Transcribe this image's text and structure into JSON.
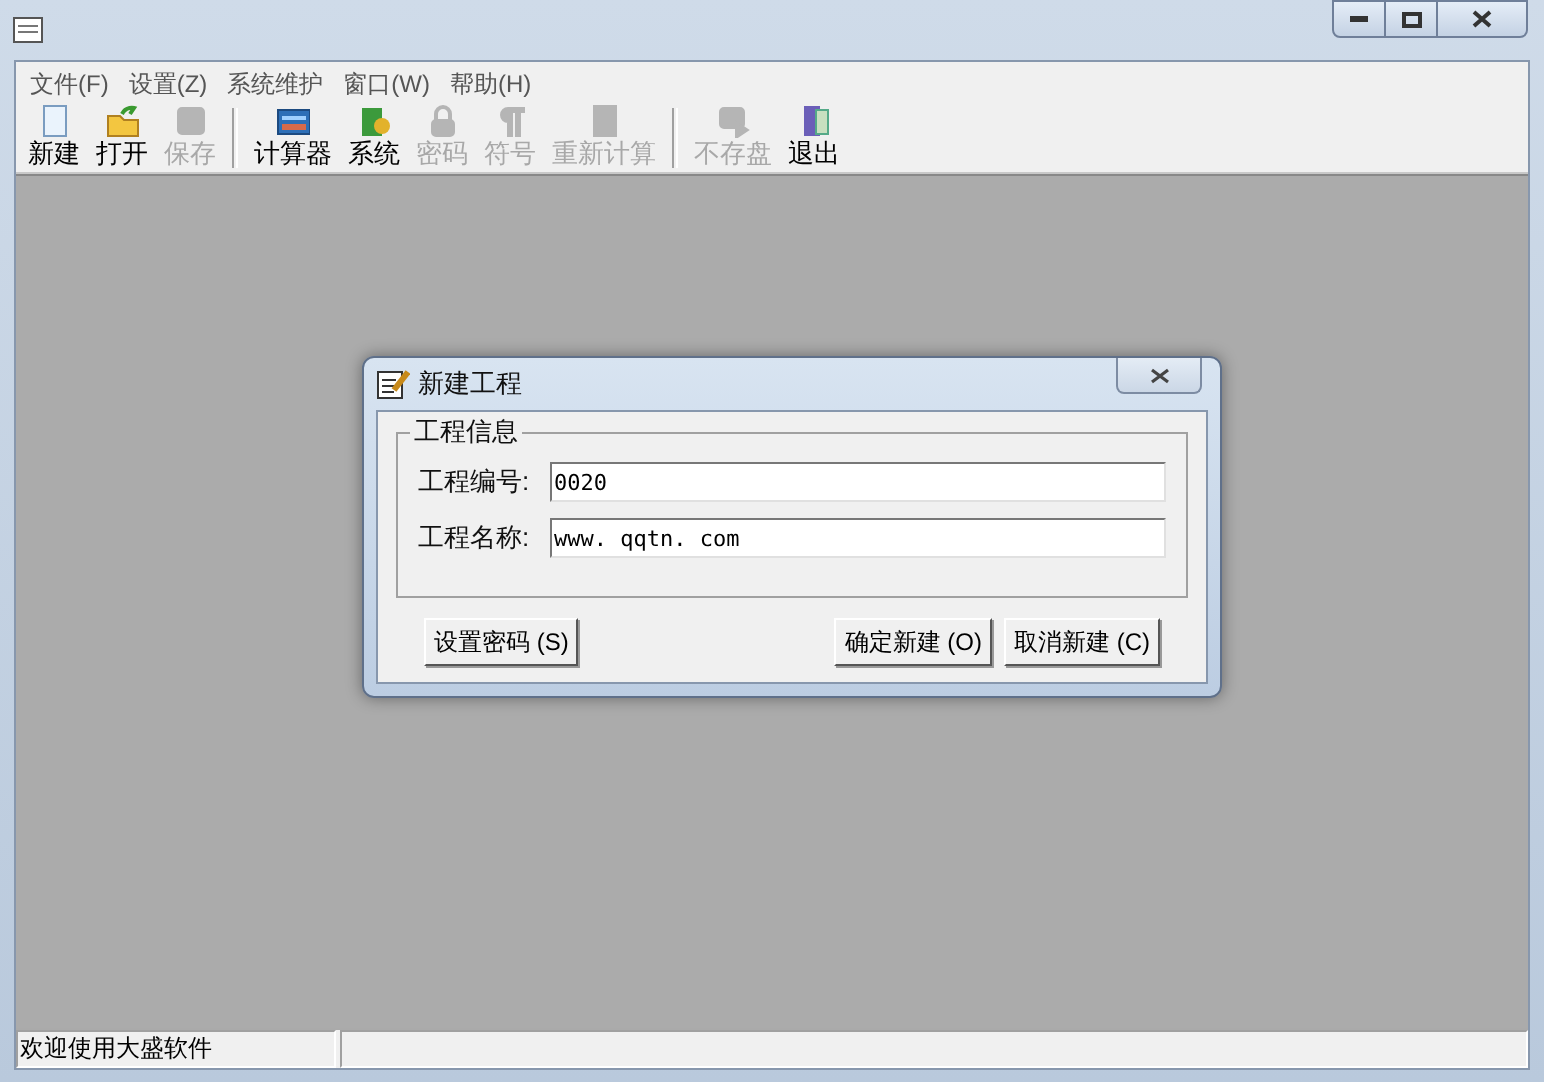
{
  "menu": [
    {
      "label": "文件(F)"
    },
    {
      "label": "设置(Z)"
    },
    {
      "label": "系统维护"
    },
    {
      "label": "窗口(W)"
    },
    {
      "label": "帮助(H)"
    }
  ],
  "toolbar": [
    {
      "kind": "button",
      "label": "新建",
      "disabled": false
    },
    {
      "kind": "button",
      "label": "打开",
      "disabled": false
    },
    {
      "kind": "button",
      "label": "保存",
      "disabled": true
    },
    {
      "kind": "separator"
    },
    {
      "kind": "button",
      "label": "计算器",
      "disabled": false
    },
    {
      "kind": "button",
      "label": "系统",
      "disabled": false
    },
    {
      "kind": "button",
      "label": "密码",
      "disabled": true
    },
    {
      "kind": "button",
      "label": "符号",
      "disabled": true
    },
    {
      "kind": "button",
      "label": "重新计算",
      "disabled": true
    },
    {
      "kind": "separator"
    },
    {
      "kind": "button",
      "label": "不存盘",
      "disabled": true
    },
    {
      "kind": "button",
      "label": "退出",
      "disabled": false
    }
  ],
  "dialog": {
    "title": "新建工程",
    "group": {
      "title": "工程信息",
      "fields": [
        {
          "label": "工程编号:",
          "value": "0020"
        },
        {
          "label": "工程名称:",
          "value": "www. qqtn. com"
        }
      ]
    },
    "buttons": [
      {
        "label": "设置密码 (S)"
      },
      {
        "label": "确定新建 (O)"
      },
      {
        "label": "取消新建 (C)"
      }
    ]
  },
  "status_bar": [
    "欢迎使用大盛软件"
  ]
}
